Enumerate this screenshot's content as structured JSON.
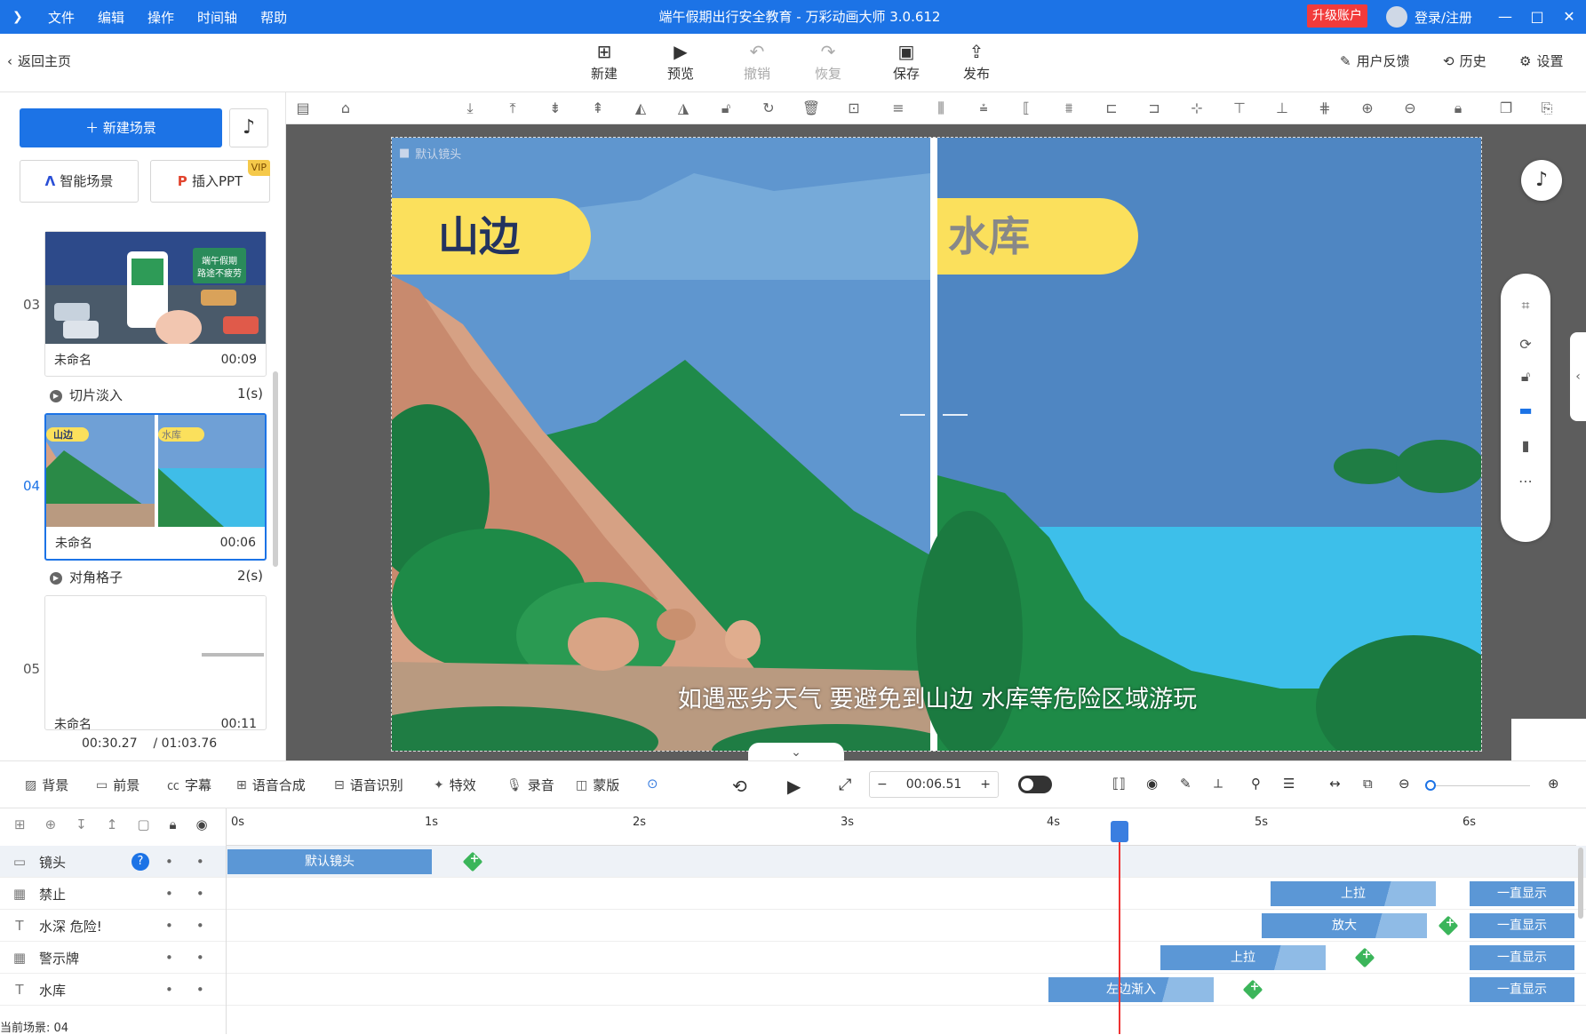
{
  "titlebar": {
    "menu": [
      "文件",
      "编辑",
      "操作",
      "时间轴",
      "帮助"
    ],
    "window_title": "端午假期出行安全教育 - 万彩动画大师 3.0.612",
    "upgrade": "升级账户",
    "login": "登录/注册",
    "min": "—",
    "max": "□",
    "close": "✕"
  },
  "toolbar": {
    "back": "返回主页",
    "new": "新建",
    "preview": "预览",
    "undo": "撤销",
    "redo": "恢复",
    "save": "保存",
    "publish": "发布",
    "feedback": "用户反馈",
    "history": "历史",
    "settings": "设置"
  },
  "left": {
    "new_scene": "新建场景",
    "smart_scene": "智能场景",
    "insert_ppt": "插入PPT",
    "vip": "VIP",
    "scenes": [
      {
        "num": "03",
        "name": "未命名",
        "duration": "00:09"
      },
      {
        "num": "04",
        "name": "未命名",
        "duration": "00:06"
      },
      {
        "num": "05",
        "name": "未命名",
        "duration": "00:11"
      }
    ],
    "transitions": [
      {
        "name": "切片淡入",
        "duration": "1(s)"
      },
      {
        "name": "对角格子",
        "duration": "2(s)"
      }
    ],
    "thumb3_sign": "端午假期 路途不疲劳",
    "thumb4_left": "山边",
    "thumb4_right": "水库",
    "current_time": "00:30.27",
    "total_time": "/ 01:03.76"
  },
  "canvas": {
    "camera_label": "默认镜头",
    "left_label": "山边",
    "right_label": "水库",
    "subtitle": "如遇恶劣天气 要避免到山边 水库等危险区域游玩"
  },
  "bottom_tools": {
    "background": "背景",
    "foreground": "前景",
    "subtitle": "字幕",
    "tts": "语音合成",
    "asr": "语音识别",
    "effects": "特效",
    "record": "录音",
    "mask": "蒙版",
    "time": "00:06.51",
    "minus": "−",
    "plus": "+"
  },
  "timeline": {
    "ticks": [
      "0s",
      "1s",
      "2s",
      "3s",
      "4s",
      "5s",
      "6s"
    ],
    "layers": [
      {
        "name": "镜头",
        "icon": "camera-icon"
      },
      {
        "name": "禁止",
        "icon": "svg-icon"
      },
      {
        "name": "水深 危险!",
        "icon": "text-icon"
      },
      {
        "name": "警示牌",
        "icon": "svg-icon"
      },
      {
        "name": "水库",
        "icon": "text-icon"
      }
    ],
    "bars": {
      "camera": "默认镜头",
      "ban": "上拉",
      "ban_end": "一直显示",
      "deep": "放大",
      "deep_end": "一直显示",
      "sign": "上拉",
      "sign_end": "一直显示",
      "res": "左边渐入",
      "res_end": "一直显示"
    },
    "current_scene": "当前场景: 04"
  }
}
